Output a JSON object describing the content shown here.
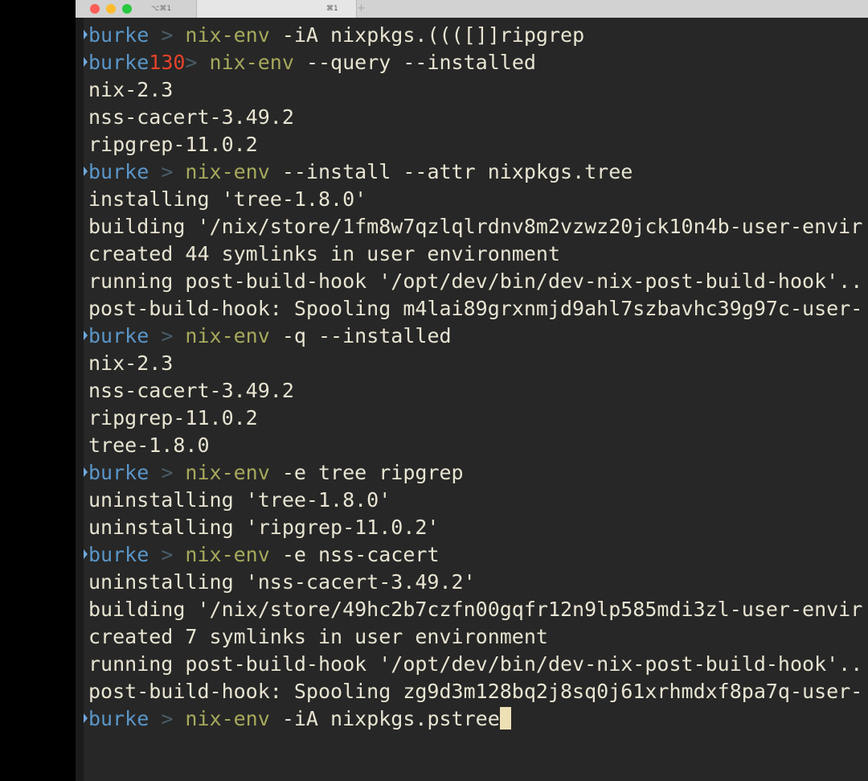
{
  "window": {
    "tabs": [
      {
        "label": "⌥⌘1"
      },
      {
        "label": "⌘1"
      }
    ],
    "new_tab_label": "+"
  },
  "terminal": {
    "lines": [
      {
        "kind": "prompt",
        "user": "burke",
        "exit": "",
        "sep": " > ",
        "cmd": "nix-env",
        "args": " -iA nixpkgs.((([]]ripgrep"
      },
      {
        "kind": "prompt",
        "user": "burke",
        "exit": "130",
        "sep": "> ",
        "cmd": "nix-env",
        "args": " --query --installed"
      },
      {
        "kind": "output",
        "text": "nix-2.3"
      },
      {
        "kind": "output",
        "text": "nss-cacert-3.49.2"
      },
      {
        "kind": "output",
        "text": "ripgrep-11.0.2"
      },
      {
        "kind": "prompt",
        "user": "burke",
        "exit": "",
        "sep": " > ",
        "cmd": "nix-env",
        "args": " --install --attr nixpkgs.tree"
      },
      {
        "kind": "output",
        "text": "installing 'tree-1.8.0'"
      },
      {
        "kind": "output",
        "text": "building '/nix/store/1fm8w7qzlqlrdnv8m2vzwz20jck10n4b-user-envir"
      },
      {
        "kind": "output",
        "text": "created 44 symlinks in user environment"
      },
      {
        "kind": "output",
        "text": "running post-build-hook '/opt/dev/bin/dev-nix-post-build-hook'.."
      },
      {
        "kind": "output",
        "text": "post-build-hook: Spooling m4lai89grxnmjd9ahl7szbavhc39g97c-user-"
      },
      {
        "kind": "prompt",
        "user": "burke",
        "exit": "",
        "sep": " > ",
        "cmd": "nix-env",
        "args": " -q --installed"
      },
      {
        "kind": "output",
        "text": "nix-2.3"
      },
      {
        "kind": "output",
        "text": "nss-cacert-3.49.2"
      },
      {
        "kind": "output",
        "text": "ripgrep-11.0.2"
      },
      {
        "kind": "output",
        "text": "tree-1.8.0"
      },
      {
        "kind": "prompt",
        "user": "burke",
        "exit": "",
        "sep": " > ",
        "cmd": "nix-env",
        "args": " -e tree ripgrep"
      },
      {
        "kind": "output",
        "text": "uninstalling 'tree-1.8.0'"
      },
      {
        "kind": "output",
        "text": "uninstalling 'ripgrep-11.0.2'"
      },
      {
        "kind": "prompt",
        "user": "burke",
        "exit": "",
        "sep": " > ",
        "cmd": "nix-env",
        "args": " -e nss-cacert"
      },
      {
        "kind": "output",
        "text": "uninstalling 'nss-cacert-3.49.2'"
      },
      {
        "kind": "output",
        "text": "building '/nix/store/49hc2b7czfn00gqfr12n9lp585mdi3zl-user-envir"
      },
      {
        "kind": "output",
        "text": "created 7 symlinks in user environment"
      },
      {
        "kind": "output",
        "text": "running post-build-hook '/opt/dev/bin/dev-nix-post-build-hook'.."
      },
      {
        "kind": "output",
        "text": "post-build-hook: Spooling zg9d3m128bq2j8sq0j61xrhmdxf8pa7q-user-"
      },
      {
        "kind": "prompt",
        "user": "burke",
        "exit": "",
        "sep": " > ",
        "cmd": "nix-env",
        "args": " -iA nixpkgs.pstree",
        "cursor": true
      }
    ]
  },
  "colors": {
    "background": "#272727",
    "text": "#e8e4d2",
    "prompt_user": "#5a96c8",
    "prompt_exit": "#e5432a",
    "command": "#a7a95c",
    "cursor": "#ede0b4"
  }
}
